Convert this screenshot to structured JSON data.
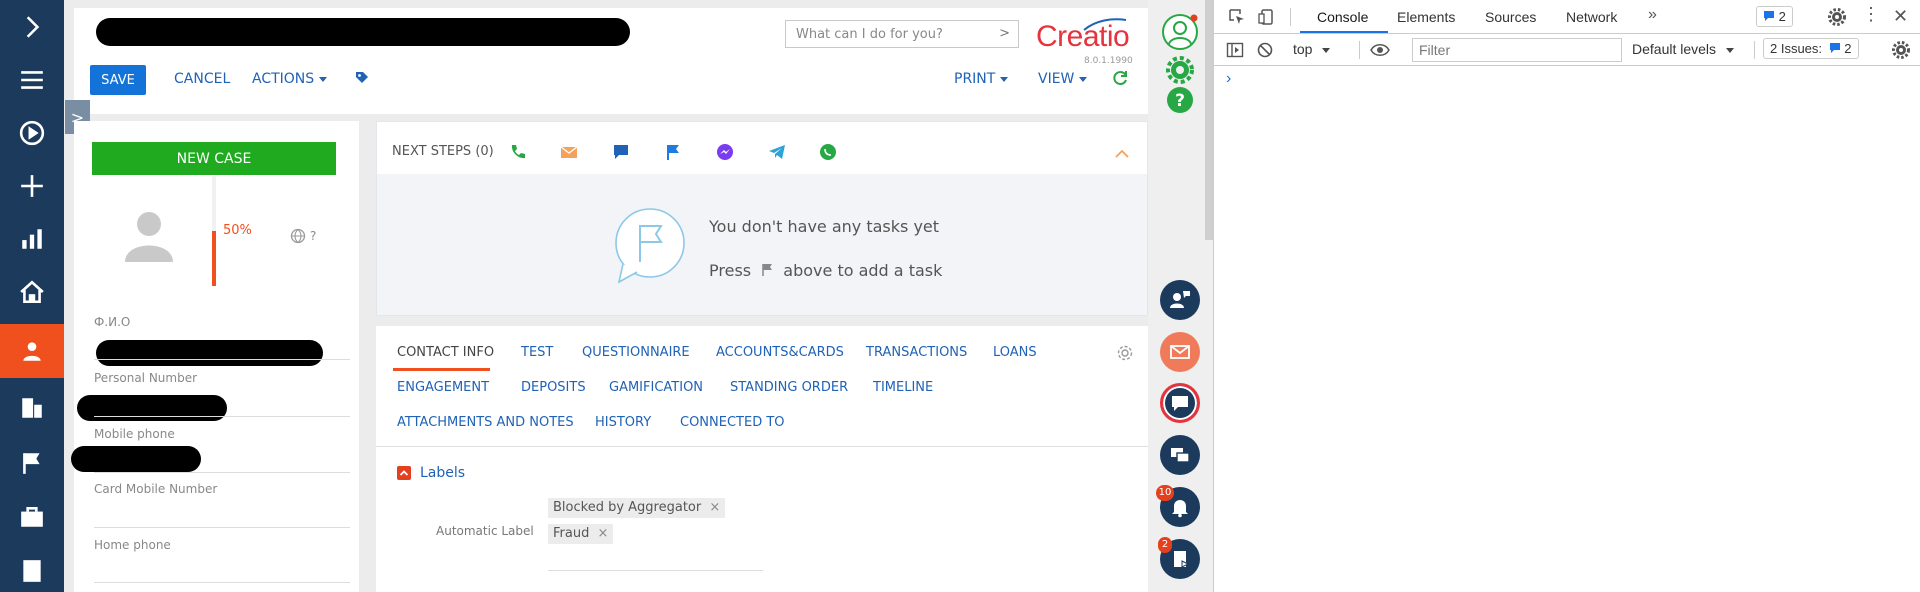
{
  "nav": {
    "items": [
      "chevron-right",
      "menu",
      "play",
      "plus",
      "bar-chart",
      "home",
      "contact",
      "building",
      "flag",
      "briefcase",
      "card"
    ]
  },
  "header": {
    "search_placeholder": "What can I do for you?",
    "logo": "Creatio",
    "version": "8.0.1.1990",
    "save_label": "SAVE",
    "cancel_label": "CANCEL",
    "actions_label": "ACTIONS",
    "print_label": "PRINT",
    "view_label": "VIEW"
  },
  "profile": {
    "new_case_label": "NEW CASE",
    "completeness": "50%",
    "timezone_text": "?",
    "fields": [
      {
        "label": "Ф.И.О"
      },
      {
        "label": "Personal Number"
      },
      {
        "label": "Mobile phone"
      },
      {
        "label": "Card Mobile Number"
      },
      {
        "label": "Home phone"
      }
    ]
  },
  "next_steps": {
    "title": "NEXT STEPS (0)",
    "empty_title": "You don't have any tasks yet",
    "empty_hint_pre": "Press",
    "empty_hint_post": "above to add a task"
  },
  "tabs": {
    "row1": [
      "CONTACT INFO",
      "TEST",
      "QUESTIONNAIRE",
      "ACCOUNTS&CARDS",
      "TRANSACTIONS",
      "LOANS"
    ],
    "row2": [
      "ENGAGEMENT",
      "DEPOSITS",
      "GAMIFICATION",
      "STANDING ORDER",
      "TIMELINE"
    ],
    "row3": [
      "ATTACHMENTS AND NOTES",
      "HISTORY",
      "CONNECTED TO"
    ]
  },
  "labels_section": {
    "title": "Labels",
    "field_label": "Automatic Label",
    "chips": [
      "Blocked by Aggregator",
      "Fraud"
    ]
  },
  "rightbar": {
    "notifications_badge": "10",
    "tasks_badge": "2"
  },
  "devtools": {
    "tabs": [
      "Console",
      "Elements",
      "Sources",
      "Network"
    ],
    "more": "»",
    "issues_badge": "2",
    "context": "top",
    "filter_placeholder": "Filter",
    "levels": "Default levels",
    "issues_label": "2 Issues:",
    "issues_count": "2",
    "prompt": "›"
  },
  "colors": {
    "nav_bg": "#1b3a5c",
    "accent": "#f0501e",
    "link": "#1f62b6",
    "save": "#1373d8",
    "new_case": "#1faa1f"
  }
}
